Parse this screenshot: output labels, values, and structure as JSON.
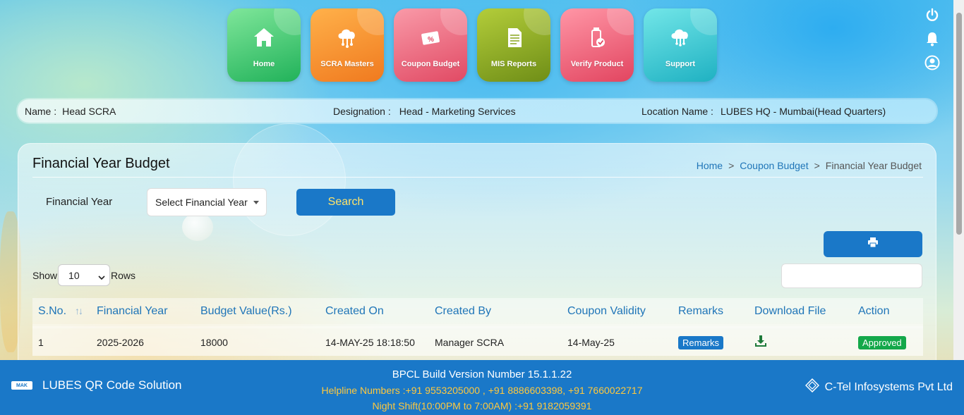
{
  "nav": {
    "tiles": [
      {
        "label": "Home",
        "icon": "home-icon"
      },
      {
        "label": "SCRA Masters",
        "icon": "cloud-network-icon"
      },
      {
        "label": "Coupon Budget",
        "icon": "coupon-icon"
      },
      {
        "label": "MIS Reports",
        "icon": "report-icon"
      },
      {
        "label": "Verify Product",
        "icon": "verify-product-icon"
      },
      {
        "label": "Support",
        "icon": "support-cloud-icon"
      }
    ]
  },
  "header_icons": [
    "power-icon",
    "bell-icon",
    "user-profile-icon"
  ],
  "user": {
    "name_label": "Name :",
    "name": "Head SCRA",
    "designation_label": "Designation :",
    "designation": "Head - Marketing Services",
    "location_label": "Location Name :",
    "location": "LUBES HQ - Mumbai(Head Quarters)"
  },
  "page": {
    "title": "Financial Year Budget",
    "breadcrumb": [
      "Home",
      "Coupon Budget",
      "Financial Year Budget"
    ],
    "breadcrumb_sep": ">"
  },
  "filter": {
    "fy_label": "Financial Year",
    "fy_select_value": "Select Financial Year",
    "search_label": "Search"
  },
  "table_controls": {
    "show_label": "Show",
    "rows_value": "10",
    "rows_label": "Rows",
    "search_value": ""
  },
  "table": {
    "columns": [
      "S.No.",
      "Financial Year",
      "Budget Value(Rs.)",
      "Created On",
      "Created By",
      "Coupon Validity",
      "Remarks",
      "Download File",
      "Action"
    ],
    "sort_indicator": "↑↓",
    "rows": [
      {
        "sno": "1",
        "financial_year": "2025-2026",
        "budget_value": "18000",
        "created_on": "14-MAY-25 18:18:50",
        "created_by": "Manager SCRA",
        "coupon_validity": "14-May-25",
        "remarks": "Remarks",
        "download_icon": "download-icon",
        "action": "Approved"
      }
    ]
  },
  "footer": {
    "logo_text": "MAK",
    "app_name": "LUBES QR Code Solution",
    "version": "BPCL Build Version Number 15.1.1.22",
    "helpline": "Helpline Numbers :+91 9553205000 , +91 8886603398, +91 7660022717",
    "night_shift": "Night Shift(10:00PM to 7:00AM) :+91 9182059391",
    "company": "C-Tel Infosystems Pvt Ltd"
  },
  "colors": {
    "primary": "#1a78c8",
    "link": "#1f75b8",
    "search_text": "#ffe36a",
    "footer_accent": "#ffc83d",
    "approved": "#14a84a"
  }
}
